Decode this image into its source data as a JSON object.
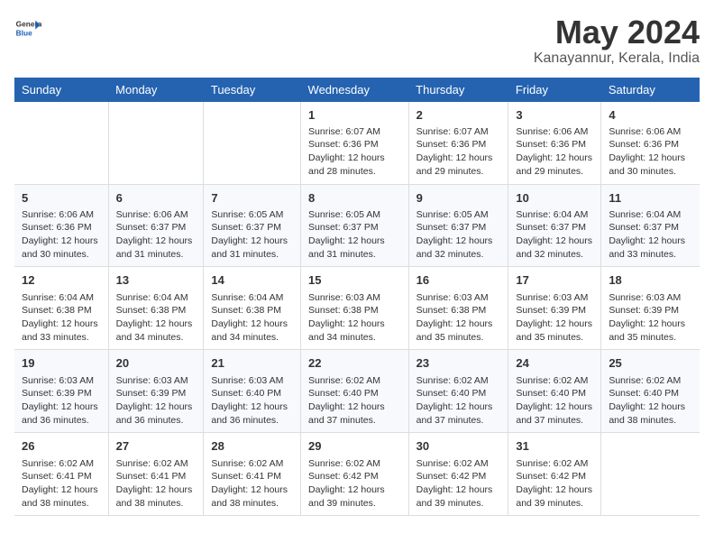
{
  "header": {
    "logo_general": "General",
    "logo_blue": "Blue",
    "month_year": "May 2024",
    "location": "Kanayannur, Kerala, India"
  },
  "weekdays": [
    "Sunday",
    "Monday",
    "Tuesday",
    "Wednesday",
    "Thursday",
    "Friday",
    "Saturday"
  ],
  "weeks": [
    {
      "days": [
        {
          "num": "",
          "info": ""
        },
        {
          "num": "",
          "info": ""
        },
        {
          "num": "",
          "info": ""
        },
        {
          "num": "1",
          "info": "Sunrise: 6:07 AM\nSunset: 6:36 PM\nDaylight: 12 hours and 28 minutes."
        },
        {
          "num": "2",
          "info": "Sunrise: 6:07 AM\nSunset: 6:36 PM\nDaylight: 12 hours and 29 minutes."
        },
        {
          "num": "3",
          "info": "Sunrise: 6:06 AM\nSunset: 6:36 PM\nDaylight: 12 hours and 29 minutes."
        },
        {
          "num": "4",
          "info": "Sunrise: 6:06 AM\nSunset: 6:36 PM\nDaylight: 12 hours and 30 minutes."
        }
      ]
    },
    {
      "days": [
        {
          "num": "5",
          "info": "Sunrise: 6:06 AM\nSunset: 6:36 PM\nDaylight: 12 hours and 30 minutes."
        },
        {
          "num": "6",
          "info": "Sunrise: 6:06 AM\nSunset: 6:37 PM\nDaylight: 12 hours and 31 minutes."
        },
        {
          "num": "7",
          "info": "Sunrise: 6:05 AM\nSunset: 6:37 PM\nDaylight: 12 hours and 31 minutes."
        },
        {
          "num": "8",
          "info": "Sunrise: 6:05 AM\nSunset: 6:37 PM\nDaylight: 12 hours and 31 minutes."
        },
        {
          "num": "9",
          "info": "Sunrise: 6:05 AM\nSunset: 6:37 PM\nDaylight: 12 hours and 32 minutes."
        },
        {
          "num": "10",
          "info": "Sunrise: 6:04 AM\nSunset: 6:37 PM\nDaylight: 12 hours and 32 minutes."
        },
        {
          "num": "11",
          "info": "Sunrise: 6:04 AM\nSunset: 6:37 PM\nDaylight: 12 hours and 33 minutes."
        }
      ]
    },
    {
      "days": [
        {
          "num": "12",
          "info": "Sunrise: 6:04 AM\nSunset: 6:38 PM\nDaylight: 12 hours and 33 minutes."
        },
        {
          "num": "13",
          "info": "Sunrise: 6:04 AM\nSunset: 6:38 PM\nDaylight: 12 hours and 34 minutes."
        },
        {
          "num": "14",
          "info": "Sunrise: 6:04 AM\nSunset: 6:38 PM\nDaylight: 12 hours and 34 minutes."
        },
        {
          "num": "15",
          "info": "Sunrise: 6:03 AM\nSunset: 6:38 PM\nDaylight: 12 hours and 34 minutes."
        },
        {
          "num": "16",
          "info": "Sunrise: 6:03 AM\nSunset: 6:38 PM\nDaylight: 12 hours and 35 minutes."
        },
        {
          "num": "17",
          "info": "Sunrise: 6:03 AM\nSunset: 6:39 PM\nDaylight: 12 hours and 35 minutes."
        },
        {
          "num": "18",
          "info": "Sunrise: 6:03 AM\nSunset: 6:39 PM\nDaylight: 12 hours and 35 minutes."
        }
      ]
    },
    {
      "days": [
        {
          "num": "19",
          "info": "Sunrise: 6:03 AM\nSunset: 6:39 PM\nDaylight: 12 hours and 36 minutes."
        },
        {
          "num": "20",
          "info": "Sunrise: 6:03 AM\nSunset: 6:39 PM\nDaylight: 12 hours and 36 minutes."
        },
        {
          "num": "21",
          "info": "Sunrise: 6:03 AM\nSunset: 6:40 PM\nDaylight: 12 hours and 36 minutes."
        },
        {
          "num": "22",
          "info": "Sunrise: 6:02 AM\nSunset: 6:40 PM\nDaylight: 12 hours and 37 minutes."
        },
        {
          "num": "23",
          "info": "Sunrise: 6:02 AM\nSunset: 6:40 PM\nDaylight: 12 hours and 37 minutes."
        },
        {
          "num": "24",
          "info": "Sunrise: 6:02 AM\nSunset: 6:40 PM\nDaylight: 12 hours and 37 minutes."
        },
        {
          "num": "25",
          "info": "Sunrise: 6:02 AM\nSunset: 6:40 PM\nDaylight: 12 hours and 38 minutes."
        }
      ]
    },
    {
      "days": [
        {
          "num": "26",
          "info": "Sunrise: 6:02 AM\nSunset: 6:41 PM\nDaylight: 12 hours and 38 minutes."
        },
        {
          "num": "27",
          "info": "Sunrise: 6:02 AM\nSunset: 6:41 PM\nDaylight: 12 hours and 38 minutes."
        },
        {
          "num": "28",
          "info": "Sunrise: 6:02 AM\nSunset: 6:41 PM\nDaylight: 12 hours and 38 minutes."
        },
        {
          "num": "29",
          "info": "Sunrise: 6:02 AM\nSunset: 6:42 PM\nDaylight: 12 hours and 39 minutes."
        },
        {
          "num": "30",
          "info": "Sunrise: 6:02 AM\nSunset: 6:42 PM\nDaylight: 12 hours and 39 minutes."
        },
        {
          "num": "31",
          "info": "Sunrise: 6:02 AM\nSunset: 6:42 PM\nDaylight: 12 hours and 39 minutes."
        },
        {
          "num": "",
          "info": ""
        }
      ]
    }
  ]
}
